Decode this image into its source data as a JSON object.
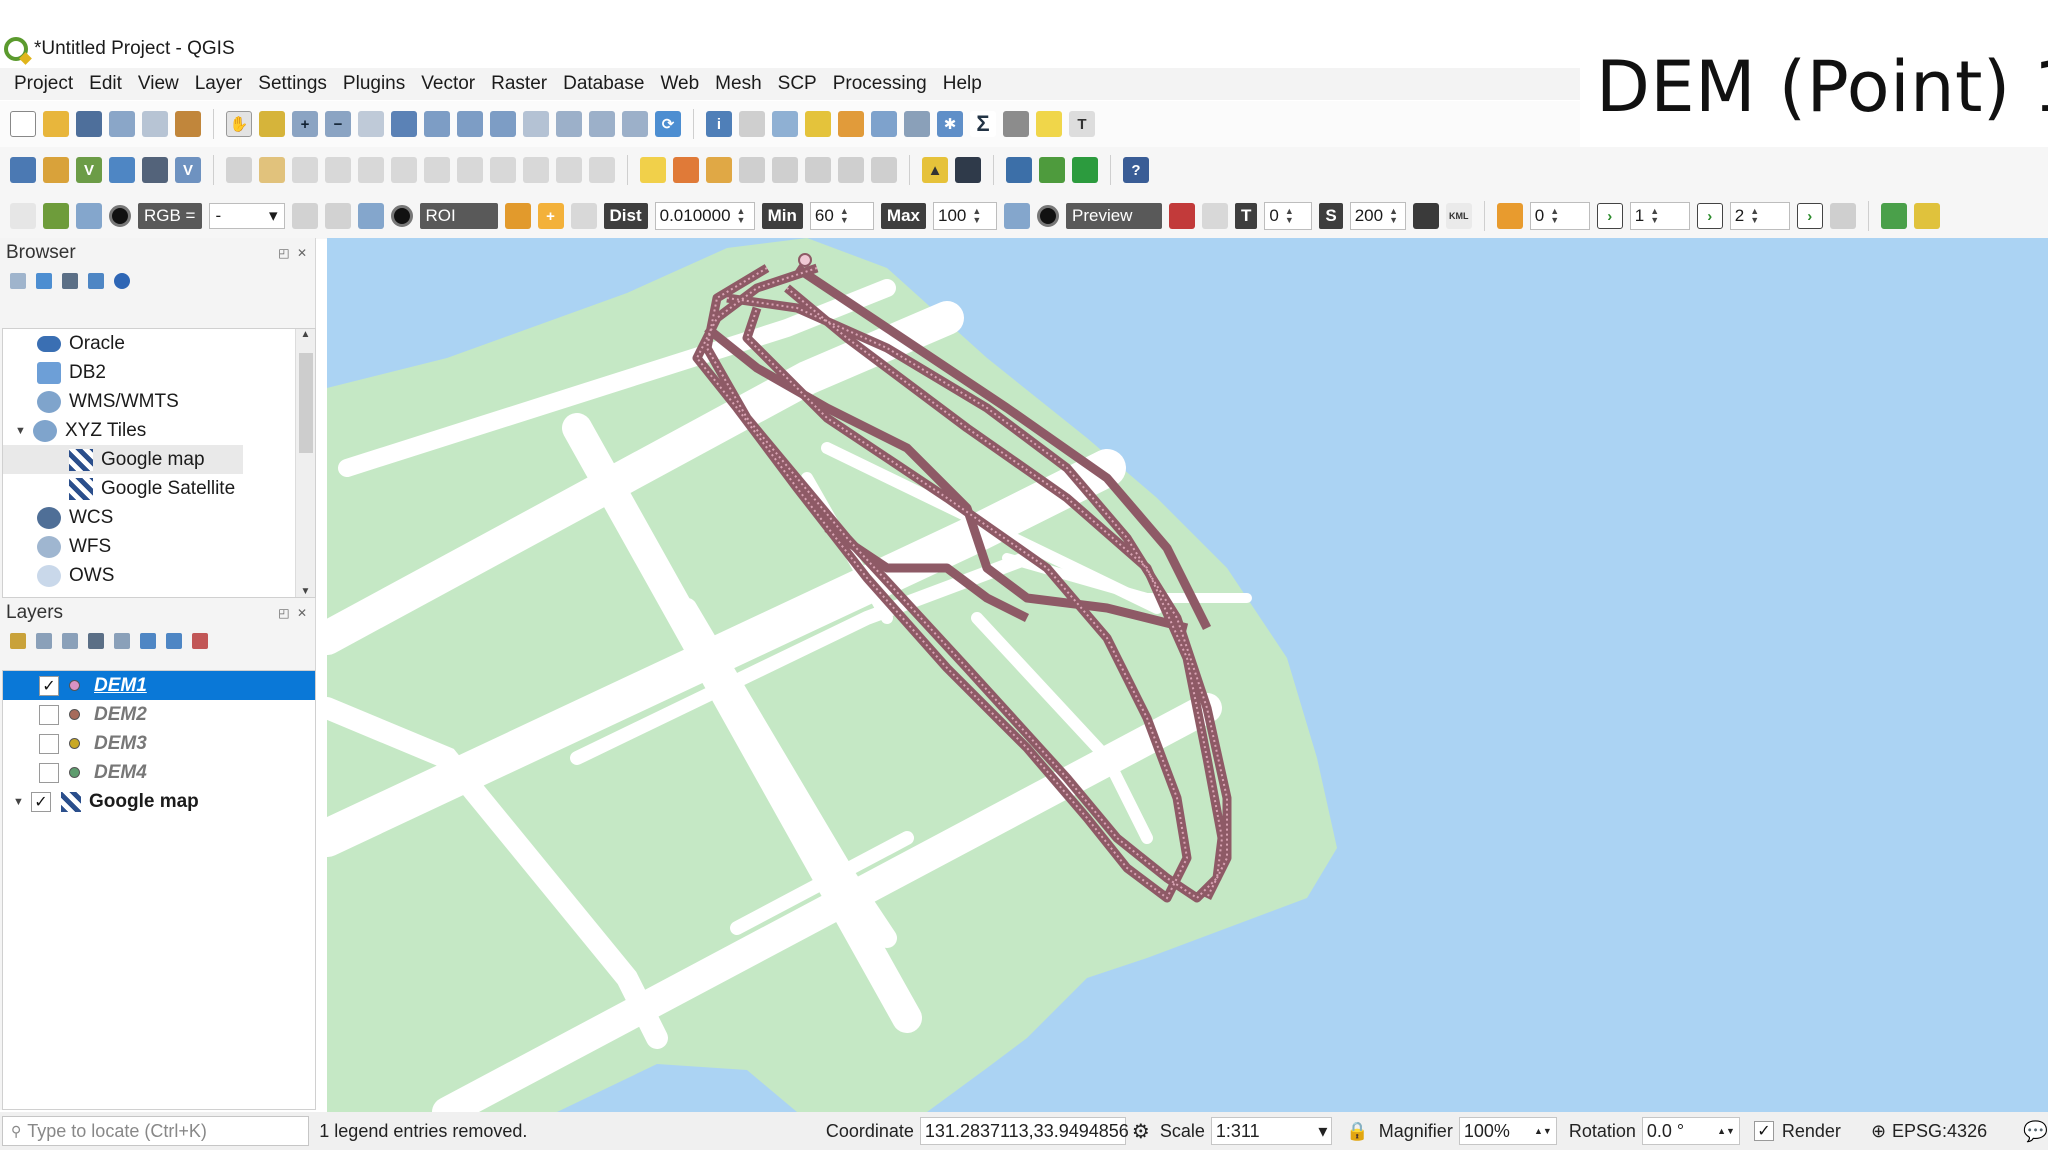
{
  "slide_title": "DEM (Point) 1",
  "window": {
    "title": "*Untitled Project - QGIS"
  },
  "menubar": [
    "Project",
    "Edit",
    "View",
    "Layer",
    "Settings",
    "Plugins",
    "Vector",
    "Raster",
    "Database",
    "Web",
    "Mesh",
    "SCP",
    "Processing",
    "Help"
  ],
  "scp_toolbar": {
    "rgb_label": "RGB =",
    "rgb_value": "-",
    "roi_label": "ROI",
    "dist_label": "Dist",
    "dist_value": "0.010000",
    "min_label": "Min",
    "min_value": "60",
    "max_label": "Max",
    "max_value": "100",
    "preview_label": "Preview",
    "t_label": "T",
    "t_value": "0",
    "s_label": "S",
    "s_value": "200",
    "kml_label": "KML",
    "band_a": "0",
    "band_b": "1",
    "band_c": "2"
  },
  "browser": {
    "title": "Browser",
    "items": [
      {
        "label": "Oracle",
        "icon": "oracle-icon",
        "level": 0
      },
      {
        "label": "DB2",
        "icon": "db2-icon",
        "level": 0
      },
      {
        "label": "WMS/WMTS",
        "icon": "globe-icon",
        "level": 0
      },
      {
        "label": "XYZ Tiles",
        "icon": "globe-icon",
        "level": 0,
        "expanded": true
      },
      {
        "label": "Google map",
        "icon": "xyz-tile-icon",
        "level": 1,
        "selected": true
      },
      {
        "label": "Google Satellite",
        "icon": "xyz-tile-icon",
        "level": 1
      },
      {
        "label": "WCS",
        "icon": "globe-icon",
        "level": 0
      },
      {
        "label": "WFS",
        "icon": "wfs-icon",
        "level": 0
      },
      {
        "label": "OWS",
        "icon": "globe-icon",
        "level": 0
      }
    ]
  },
  "layers": {
    "title": "Layers",
    "items": [
      {
        "name": "DEM1",
        "checked": true,
        "color": "#d993c4",
        "active": true
      },
      {
        "name": "DEM2",
        "checked": false,
        "color": "#a66b5b"
      },
      {
        "name": "DEM3",
        "checked": false,
        "color": "#c9a824"
      },
      {
        "name": "DEM4",
        "checked": false,
        "color": "#5e9c6e"
      },
      {
        "name": "Google map",
        "checked": true,
        "group": true
      }
    ]
  },
  "map": {
    "water_color": "#abd3f3",
    "land_color": "#c5e8c5",
    "road_color": "#ffffff",
    "track_color": "#8e5a66"
  },
  "statusbar": {
    "locator_placeholder": "Type to locate (Ctrl+K)",
    "message": "1 legend entries removed.",
    "coordinate_label": "Coordinate",
    "coordinate_value": "131.2837113,33.9494856",
    "scale_label": "Scale",
    "scale_value": "1:311",
    "magnifier_label": "Magnifier",
    "magnifier_value": "100%",
    "rotation_label": "Rotation",
    "rotation_value": "0.0 °",
    "render_label": "Render",
    "crs": "EPSG:4326"
  }
}
